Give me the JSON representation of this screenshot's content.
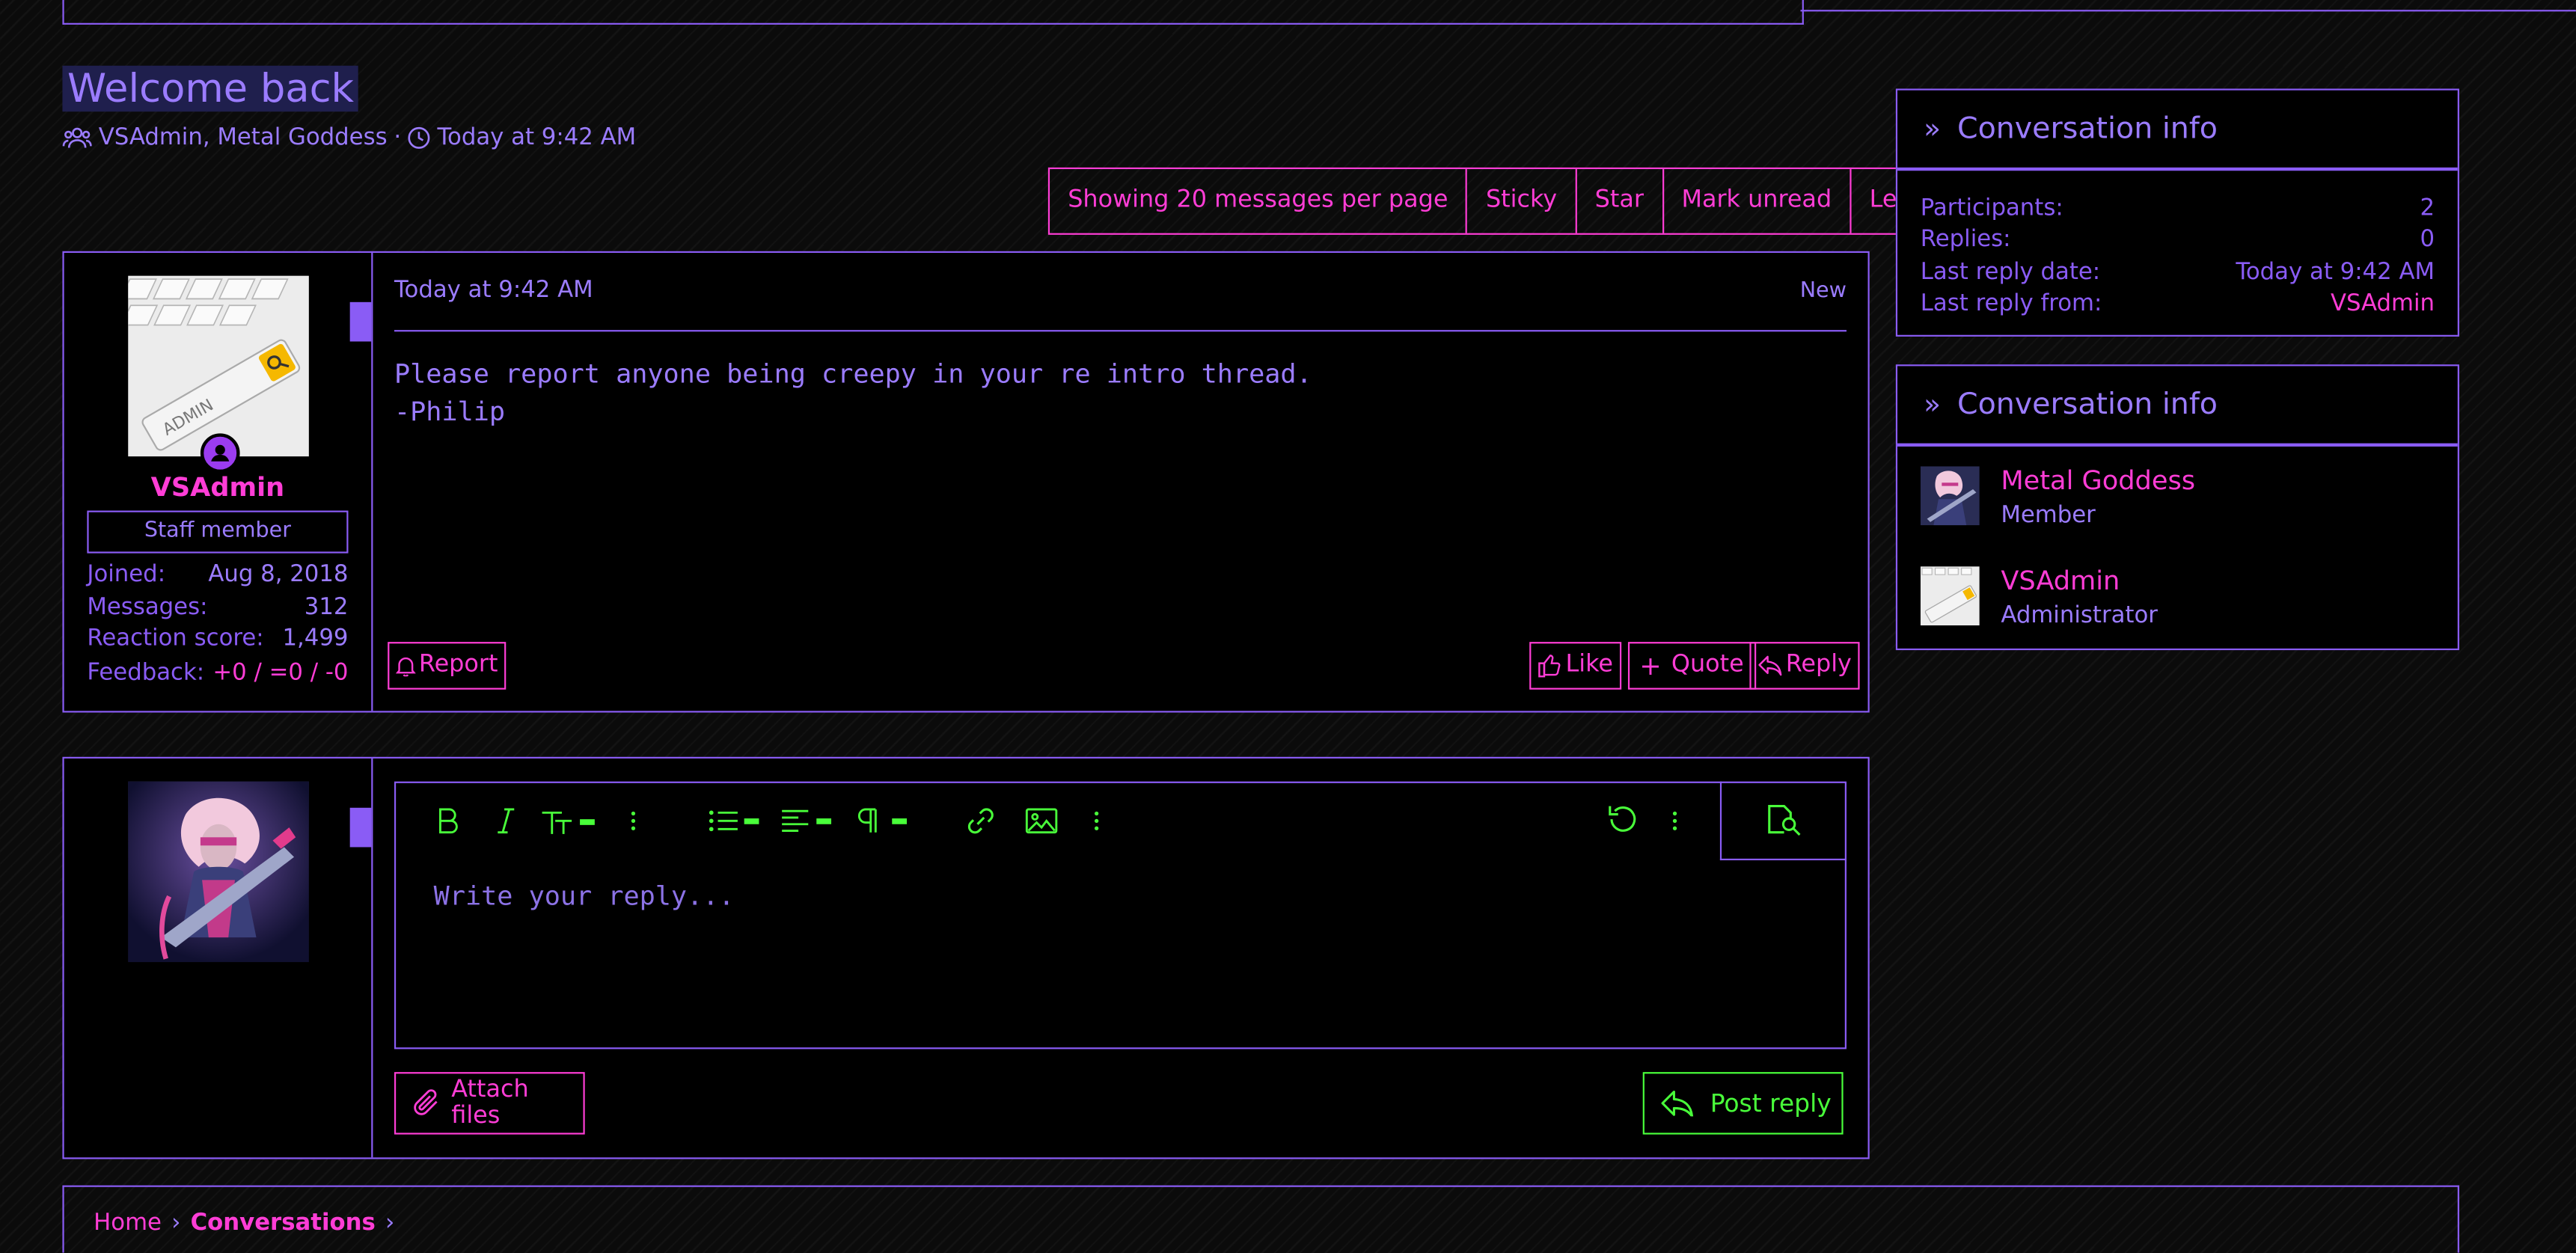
{
  "page": {
    "title": "Welcome back",
    "participants": "VSAdmin, Metal Goddess",
    "separator": "·",
    "date": "Today at 9:42 AM"
  },
  "actions": {
    "per_page": "Showing 20 messages per page",
    "sticky": "Sticky",
    "star": "Star",
    "mark_unread": "Mark unread",
    "leave": "Leave"
  },
  "post": {
    "username": "VSAdmin",
    "role_badge": "Staff member",
    "avatar_text": "ADMIN",
    "stats": [
      {
        "label": "Joined:",
        "value": "Aug 8, 2018"
      },
      {
        "label": "Messages:",
        "value": "312"
      },
      {
        "label": "Reaction score:",
        "value": "1,499"
      },
      {
        "label": "Feedback:",
        "value": "+0 / =0 / -0"
      }
    ],
    "date": "Today at 9:42 AM",
    "new_label": "New",
    "body_line1": "Please report anyone being creepy in your re intro thread.",
    "body_line2": "-Philip",
    "report": "Report",
    "like": "Like",
    "quote": "Quote",
    "reply": "Reply"
  },
  "editor": {
    "placeholder": "Write your reply...",
    "attach": "Attach files",
    "post_reply": "Post reply"
  },
  "sidebar": {
    "info_title": "Conversation info",
    "info_rows": [
      {
        "label": "Participants:",
        "value": "2"
      },
      {
        "label": "Replies:",
        "value": "0"
      },
      {
        "label": "Last reply date:",
        "value": "Today at 9:42 AM"
      },
      {
        "label": "Last reply from:",
        "value": "VSAdmin"
      }
    ],
    "members_title": "Conversation info",
    "members": [
      {
        "name": "Metal Goddess",
        "role": "Member"
      },
      {
        "name": "VSAdmin",
        "role": "Administrator"
      }
    ]
  },
  "breadcrumb": {
    "home": "Home",
    "conversations": "Conversations",
    "sep": "›"
  },
  "colors": {
    "accent_purple": "#8a5cf5",
    "link_pink": "#ff3dd6",
    "editor_green": "#49ff3a"
  }
}
